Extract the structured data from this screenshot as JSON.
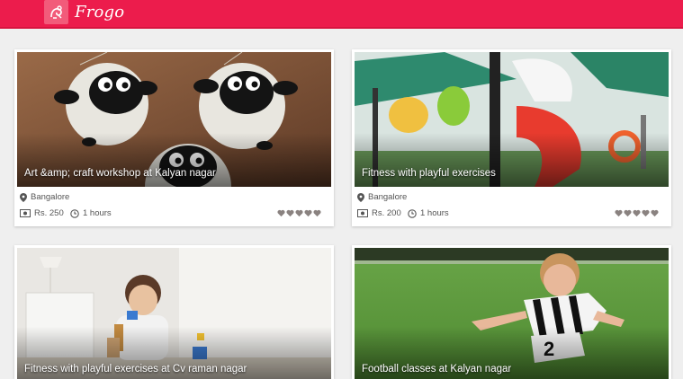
{
  "app": {
    "name": "Frogo"
  },
  "colors": {
    "brand": "#ec1c4c",
    "star": "#8a8280",
    "meta_text": "#555555"
  },
  "cards": [
    {
      "title": "Art &amp; craft workshop at Kalyan nagar",
      "location": "Bangalore",
      "price": "Rs. 250",
      "duration": "1 hours",
      "rating_icons": 5
    },
    {
      "title": "Fitness with playful exercises",
      "location": "Bangalore",
      "price": "Rs. 200",
      "duration": "1 hours",
      "rating_icons": 5
    },
    {
      "title": "Fitness with playful exercises at Cv raman nagar"
    },
    {
      "title": "Football classes at Kalyan nagar"
    }
  ]
}
